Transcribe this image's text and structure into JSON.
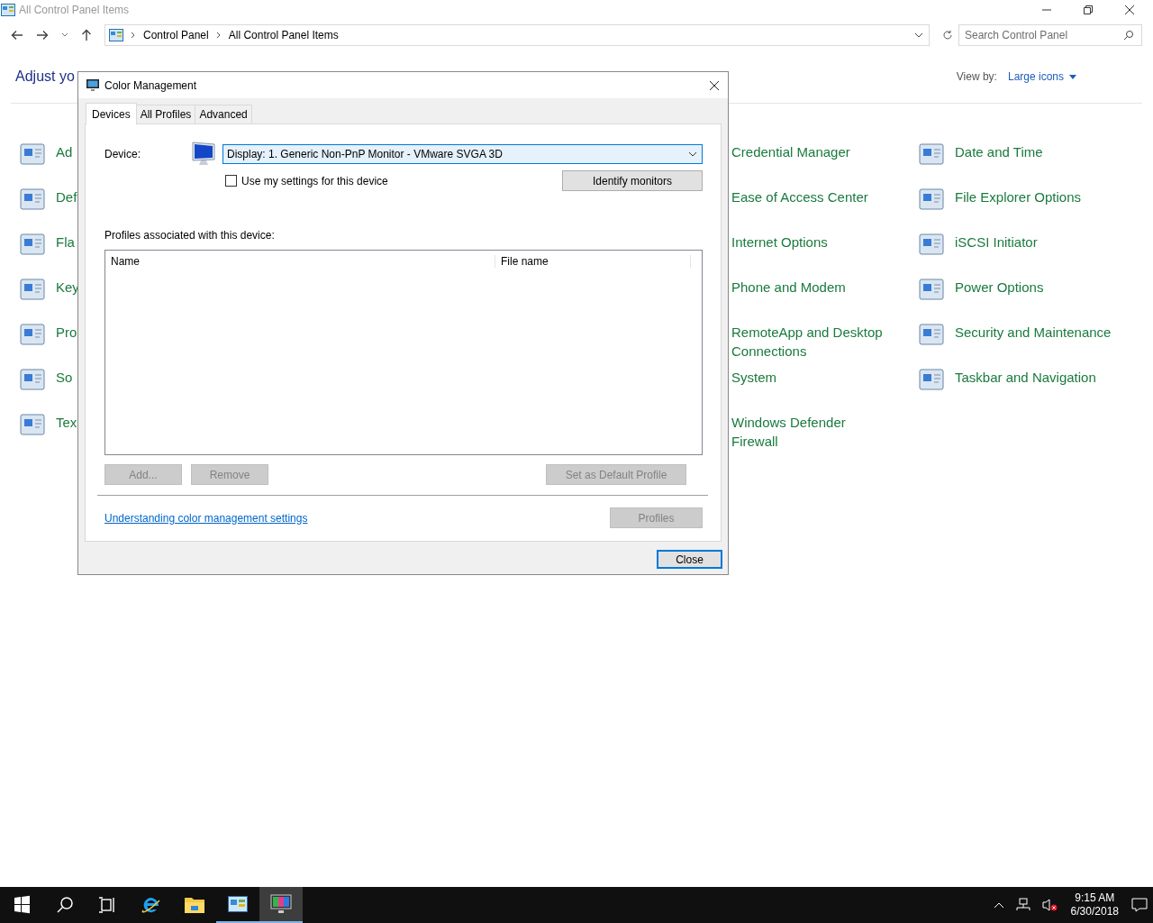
{
  "window": {
    "title": "All Control Panel Items"
  },
  "address_bar": {
    "breadcrumbs": [
      "Control Panel",
      "All Control Panel Items"
    ]
  },
  "search": {
    "placeholder": "Search Control Panel"
  },
  "heading": "Adjust yo",
  "view_by": {
    "label": "View by:",
    "value": "Large icons"
  },
  "items_left": [
    "Ad",
    "Def",
    "Fla",
    "Key",
    "Pro",
    "So",
    "Tex"
  ],
  "items_middle": [
    "Credential Manager",
    "Ease of Access Center",
    "Internet Options",
    "Phone and Modem",
    "RemoteApp and Desktop Connections",
    "System",
    "Windows Defender Firewall"
  ],
  "items_right": [
    "Date and Time",
    "File Explorer Options",
    "iSCSI Initiator",
    "Power Options",
    "Security and Maintenance",
    "Taskbar and Navigation"
  ],
  "dialog": {
    "title": "Color Management",
    "tabs": [
      {
        "label": "Devices",
        "selected": true
      },
      {
        "label": "All Profiles",
        "selected": false
      },
      {
        "label": "Advanced",
        "selected": false
      }
    ],
    "device_label": "Device:",
    "device_value": "Display: 1. Generic Non-PnP Monitor - VMware SVGA 3D",
    "use_settings": {
      "label": "Use my settings for this device",
      "checked": false
    },
    "identify_button": {
      "label": "Identify monitors",
      "disabled": false
    },
    "profiles_label": "Profiles associated with this device:",
    "columns": [
      "Name",
      "File name"
    ],
    "buttons": [
      {
        "label": "Add...",
        "disabled": true
      },
      {
        "label": "Remove",
        "disabled": true
      },
      {
        "label": "Set as Default Profile",
        "disabled": true
      }
    ],
    "link": "Understanding color management settings",
    "profiles_button": {
      "label": "Profiles",
      "disabled": true
    },
    "close_button": {
      "label": "Close",
      "disabled": false
    }
  },
  "taskbar": {
    "apps": [
      {
        "selected": false,
        "running": false
      },
      {
        "selected": false,
        "running": false
      },
      {
        "selected": false,
        "running": true
      },
      {
        "selected": true,
        "running": true
      }
    ]
  },
  "clock": {
    "time": "9:15 AM",
    "date": "6/30/2018"
  }
}
